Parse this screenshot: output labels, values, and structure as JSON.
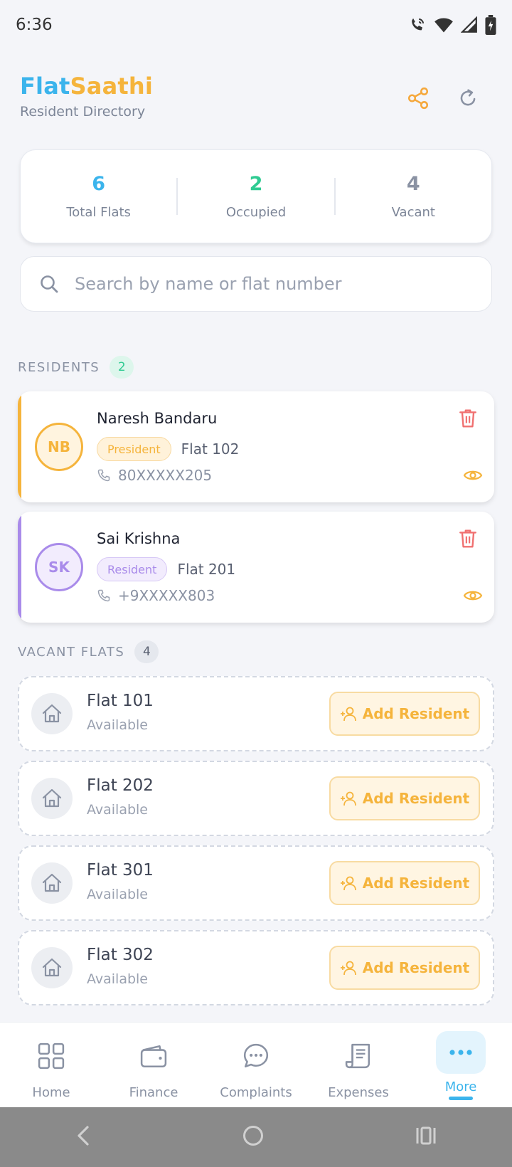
{
  "status_bar": {
    "time": "6:36"
  },
  "header": {
    "brand_part1": "Flat",
    "brand_part2": "Saathi",
    "subtitle": "Resident Directory",
    "brand_colors": {
      "primary": "#3BB4EC",
      "secondary": "#F5B43C"
    }
  },
  "stats": [
    {
      "value": "6",
      "label": "Total Flats",
      "color": "#3BB4EC"
    },
    {
      "value": "2",
      "label": "Occupied",
      "color": "#2FCB92"
    },
    {
      "value": "4",
      "label": "Vacant",
      "color": "#8A92A3"
    }
  ],
  "search": {
    "placeholder": "Search by name or flat number",
    "value": ""
  },
  "residents_section": {
    "title": "RESIDENTS",
    "count": "2"
  },
  "residents": [
    {
      "initials": "NB",
      "name": "Naresh Bandaru",
      "role": "President",
      "flat": "Flat 102",
      "phone": "80XXXXX205",
      "accent": "#F5B43C"
    },
    {
      "initials": "SK",
      "name": "Sai Krishna",
      "role": "Resident",
      "flat": "Flat 201",
      "phone": "+9XXXXX803",
      "accent": "#A98BEA"
    }
  ],
  "vacant_section": {
    "title": "VACANT FLATS",
    "count": "4"
  },
  "vacant_flats": [
    {
      "name": "Flat 101",
      "status": "Available",
      "action": "Add Resident"
    },
    {
      "name": "Flat 202",
      "status": "Available",
      "action": "Add Resident"
    },
    {
      "name": "Flat 301",
      "status": "Available",
      "action": "Add Resident"
    },
    {
      "name": "Flat 302",
      "status": "Available",
      "action": "Add Resident"
    }
  ],
  "bottom_nav": [
    {
      "label": "Home",
      "icon": "grid-icon"
    },
    {
      "label": "Finance",
      "icon": "wallet-icon"
    },
    {
      "label": "Complaints",
      "icon": "chat-bubble-icon"
    },
    {
      "label": "Expenses",
      "icon": "receipt-icon"
    },
    {
      "label": "More",
      "icon": "more-dots-icon",
      "active": true
    }
  ]
}
